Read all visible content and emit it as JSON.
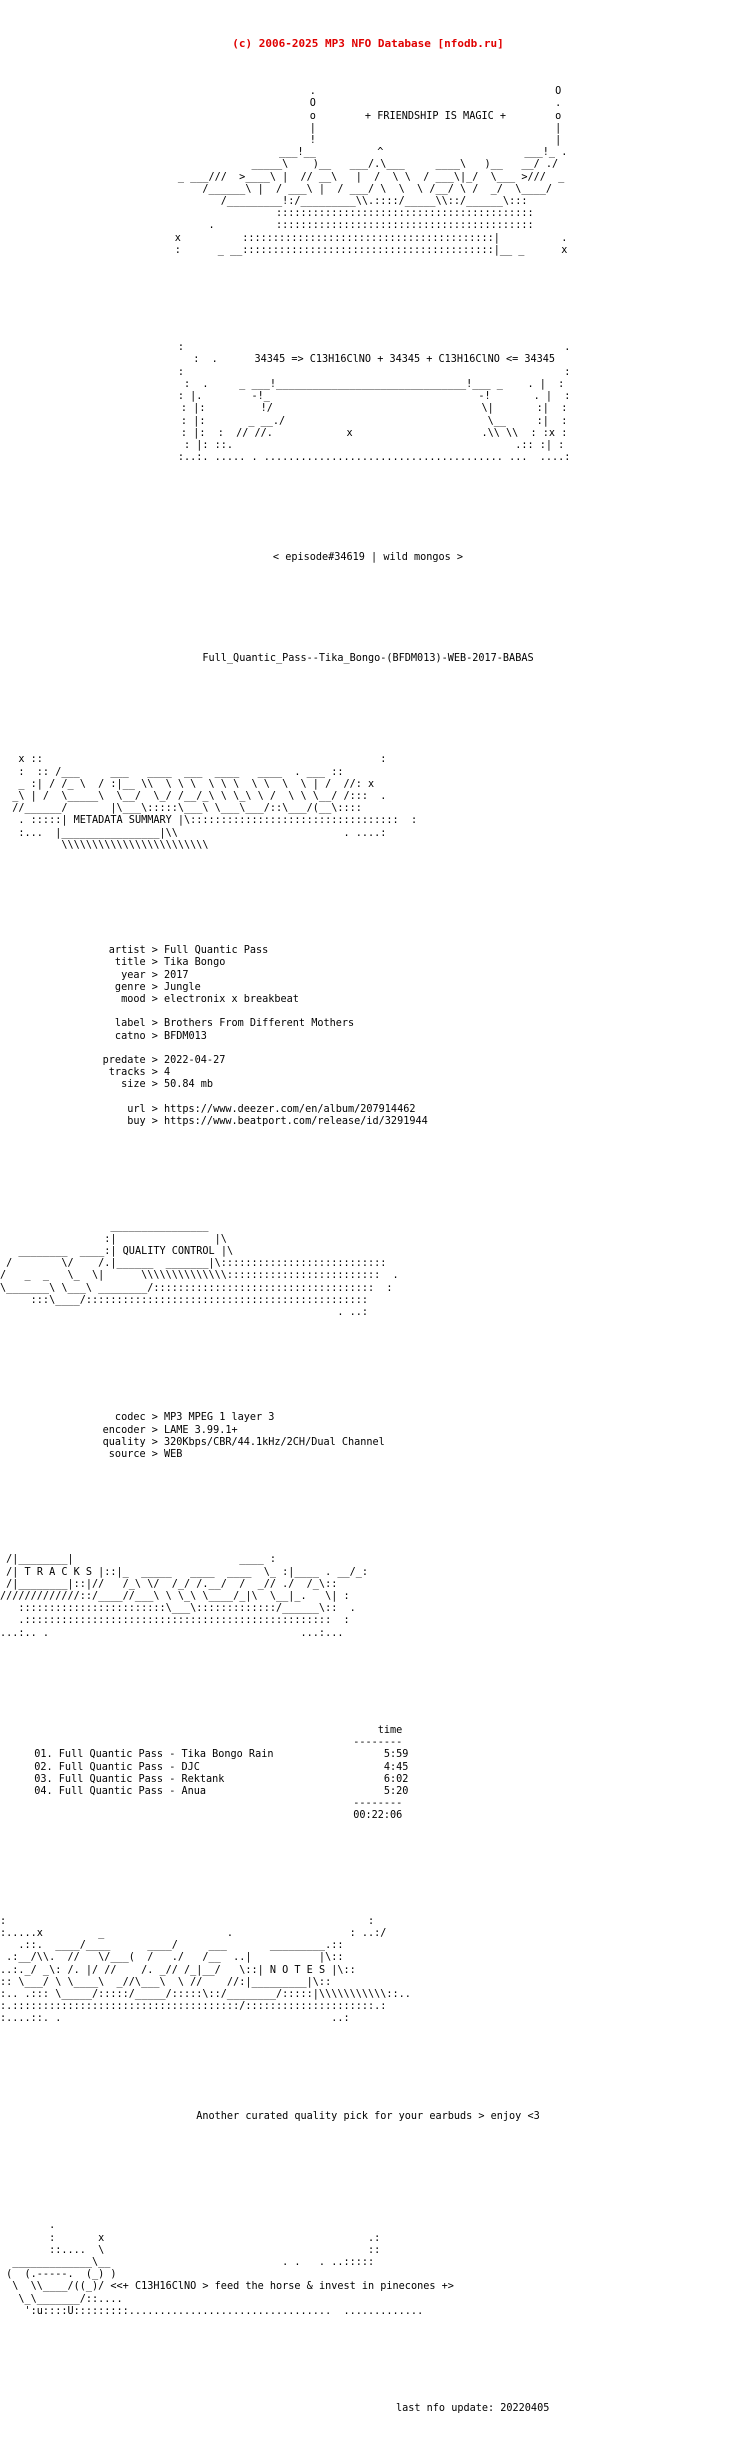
{
  "site": {
    "copyright": "(c) 2006-2025 MP3 NFO Database [nfodb.ru]",
    "accent_color": "#e00000",
    "text_color": "#000000",
    "background_color": "#ffffff"
  },
  "header": {
    "tagline": "+ FRIENDSHIP IS MAGIC +",
    "formula_line": "34345 => C13H16ClNO + 34345 + C13H16ClNO <= 34345",
    "episode_line": "< episode#34619 | wild mongos >",
    "release_name": "Full_Quantic_Pass--Tika_Bongo-(BFDM013)-WEB-2017-BABAS",
    "ascii_top": [
      "                       .                              O",
      "                       O                              .",
      "                       o            + FRIENDSHIP IS MAGIC +           o",
      "                       |                              |",
      "                       !                              |",
      "              ______!__                 ^             ______  )_",
      "        _____\\    )__/ \\               /.\\      _____\\    )_/",
      " _ __///  >___\\ |  //  _\\    )  |   _/  \\ \\  ./__/ /  \\ ___ >///  _",
      "   /_______\\ |  / ____\\ |  /___/ \\ \\___  \\ /_  \\__/ ///",
      "  /__________!_/ .      \\__/::/__\\\\.::::/_  \\\\ )_ \\______//"
    ],
    "ascii_mid": [
      ":!::::::::::::::::::::::::::::::::::::::::::",
      ":::::::::::::::::::::::::::::::::::::::::::::",
      "::::::::::::::::::::::::::::::::::::::::::::|",
      ":::::::::::::::::::::::::::::::::::::::::::::",
      ":::::::::::::::::::::::::::::::::::::::::::::"
    ]
  },
  "metadata_banner": {
    "label": "METADATA SUMMARY"
  },
  "metadata": {
    "rows": [
      {
        "key": "artist",
        "value": "Full Quantic Pass"
      },
      {
        "key": "title",
        "value": "Tika Bongo"
      },
      {
        "key": "year",
        "value": "2017"
      },
      {
        "key": "genre",
        "value": "Jungle"
      },
      {
        "key": "mood",
        "value": "electronix x breakbeat"
      }
    ],
    "rows2": [
      {
        "key": "label",
        "value": "Brothers From Different Mothers"
      },
      {
        "key": "catno",
        "value": "BFDM013"
      }
    ],
    "rows3": [
      {
        "key": "predate",
        "value": "2022-04-27"
      },
      {
        "key": "tracks",
        "value": "4"
      },
      {
        "key": "size",
        "value": "50.84 mb"
      }
    ],
    "rows4": [
      {
        "key": "url",
        "value": "https://www.deezer.com/en/album/207914462"
      },
      {
        "key": "buy",
        "value": "https://www.beatport.com/release/id/3291944"
      }
    ],
    "block_text": "      artist > Full Quantic Pass\n       title > Tika Bongo\n        year > 2017\n       genre > Jungle\n        mood > electronix x breakbeat\n\n       label > Brothers From Different Mothers\n       catno > BFDM013\n\n     predate > 2022-04-27\n      tracks > 4\n        size > 50.84 mb\n\n         url > https://www.deezer.com/en/album/207914462\n         buy > https://www.beatport.com/release/id/3291944"
  },
  "quality_banner": {
    "label": "QUALITY CONTROL"
  },
  "quality": {
    "rows": [
      {
        "key": "codec",
        "value": "MP3 MPEG 1 layer 3"
      },
      {
        "key": "encoder",
        "value": "LAME 3.99.1+"
      },
      {
        "key": "quality",
        "value": "320Kbps/CBR/44.1kHz/2CH/Dual Channel"
      },
      {
        "key": "source",
        "value": "WEB"
      }
    ],
    "block_text": "       codec > MP3 MPEG 1 layer 3\n     encoder > LAME 3.99.1+\n     quality > 320Kbps/CBR/44.1kHz/2CH/Dual Channel\n      source > WEB"
  },
  "tracks_banner": {
    "label": "T R A C K S"
  },
  "tracklist": {
    "time_header": "time",
    "rule": "--------",
    "total": "00:22:06",
    "items": [
      {
        "num": "01.",
        "title": "Full Quantic Pass - Tika Bongo Rain",
        "time": "5:59"
      },
      {
        "num": "02.",
        "title": "Full Quantic Pass - DJC",
        "time": "4:45"
      },
      {
        "num": "03.",
        "title": "Full Quantic Pass - Rektank",
        "time": "6:02"
      },
      {
        "num": "04.",
        "title": "Full Quantic Pass - Anua",
        "time": "5:20"
      }
    ],
    "block_text": "                                                          time\n                                                      --------\n  01. Full Quantic Pass - Tika Bongo Rain                  5:59\n  02. Full Quantic Pass - DJC                              4:45\n  03. Full Quantic Pass - Rektank                          6:02\n  04. Full Quantic Pass - Anua                             5:20\n                                                      --------\n                                                      00:22:06"
  },
  "notes_banner": {
    "label": "N O T E S"
  },
  "notes": {
    "text": "Another curated quality pick for your earbuds > enjoy <3"
  },
  "footer": {
    "horse_line": "<<+ C13H16ClNO > feed the horse & invest in pinecones +>",
    "last_update_label": "last nfo update:",
    "last_update_value": "20220405",
    "last_update_line": "last nfo update: 20220405"
  },
  "art": {
    "header_logo": "                      .                                      O\n                      O                                      .\n                      o           + FRIENDSHIP IS MAGIC +    o\n                      |                                      |\n                      !                                      |\n                   ___!__           ^                     ___!_  .\n             _____\\     )__   __/.\\    _____\\    )_   ___/_ ./\n    _ ___///  >____\\ |  //  _\\  |  / _____ \\ |  /  _\\_!_/  \\     )>///  _\n     /_______\\ |  /  \\____\\ |  /    \\  \\    /__/  \\ /  _/   \\____/\n    /_________/ .    \\___/::/__\\\\.::::/ \\_/ )_  \\_____\\::\n",
    "meta_logo": "  x ::                                                          :\n  : :: /____       ____   ____  ____  _____   ____    . ____ ::  x\n  _ :| / /_ \\  / :|__ \\\\  \\ \\ \\  \\ \\ \\  \\ \\   \\  \\  | /  // : .\n _\\ | /  \\_____\\  \\__/  \\_/ /__/_\\_\\ \\_\\ \\_/ /  \\ \\ \\__/ /:::\n //______/      |\\___\\:::::\\___\\ \\___\\___/::\\___/(__\\::::   :\n  . :::::| METADATA SUMMARY |\\:::::::::::::::::::::::::::::::  :\n  :... |_________________|\\\\                        .  ....:\n        \\\\\\\\\\\\\\\\\\\\\\\\\\\\\\\\\\\\\\\\",
    "quality_logo": "                    _______________\n                   :|               |\\\n    ________  _____:| QUALITY CONTROL |\\\n  /        \\/     /.|_____  ________|\\::::::::::::::::::::::::::\n /   _  _   \\_   \\|     \\\\\\\\\\\\\\\\\\\\\\\\::::::::::::::::::::::::::  .\n \\____\\ \\___ ________/::::::::::::::::::::::::::::::::::::::::  :\n   :::\\____/:::::::::::::::::::::::::::::::::::::::::::::::::  . ..:",
    "tracks_logo": " /|_________|\n /| T R A C K S |::|_  ______   _____     __  ___ .  __ /_:\n /|_________|::|//   /_\\ \\/   /_/ /.__/ /  _// ./  /_\\::\n/////////////::/____//___\\ \\ \\ \\____/_|\\  \\__|_.   \\|  :\n  :::::::::::::::::::::::\\___\\:::::::::::::/______\\::  .\n  .:::::::::::::::::::::::::::::::::::::::::::::::::  :\n...:.. .                                        ...:...",
    "notes_logo": ":           .                                              :\n:.....x          _                    .               : ..:/\n   .::.  _____/_____      ____/    ____      ________.::\n .:___/\\\\.  //    \\/___(  /   ./  /__ ..|           |\\::\n..:._/ _\\: /. |/ //     /. _// /_|__/  \\::| N O T E S |\\::\n:: \\___/ \\ \\____\\   _//\\___\\  \\ //   //:|_________|\\::\n:.. .::: \\_____/:::::/_____/:::::\\::/_________/::::|\\\\\\\\\\\\\\\\\\\\::..\n:.::::::::::::::::::::::::::::::::::::::/::::::::::::::::::::::.:\n:....::. .                                              ..:",
    "footer_art": "        .\n        :        x                                        .:\n        ::....  \\                                         ::\n  ______________\\__                          . .   . ..:::::\n (  (.-----.  (_) )\n  \\  \\\\____/((_)/ \n   \\_\\_______/::....\n    ':u::::U:::::::::..................................  ..............."
  }
}
